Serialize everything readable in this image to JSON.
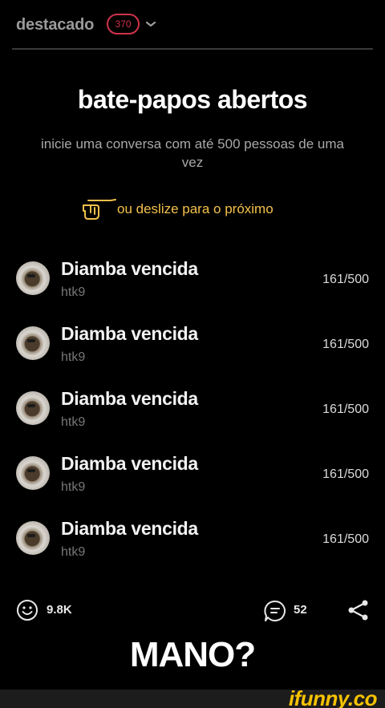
{
  "header": {
    "title": "destacado",
    "badge_count": "370"
  },
  "intro": {
    "headline": "bate-papos abertos",
    "subtitle": "inicie uma conversa com até 500 pessoas de uma vez",
    "swipe_hint": "ou deslize para o próximo"
  },
  "chats": [
    {
      "name": "Diamba vencida",
      "sub": "htk9",
      "count": "161/500"
    },
    {
      "name": "Diamba vencida",
      "sub": "htk9",
      "count": "161/500"
    },
    {
      "name": "Diamba vencida",
      "sub": "htk9",
      "count": "161/500"
    },
    {
      "name": "Diamba vencida",
      "sub": "htk9",
      "count": "161/500"
    },
    {
      "name": "Diamba vencida",
      "sub": "htk9",
      "count": "161/500"
    }
  ],
  "actions": {
    "likes": "9.8K",
    "comments": "52"
  },
  "caption": "MANO?",
  "footer": {
    "brand": "ifunny.co"
  },
  "colors": {
    "badge": "#d0334a",
    "swipe_accent": "#f3c14b",
    "brand": "#f5c200"
  }
}
